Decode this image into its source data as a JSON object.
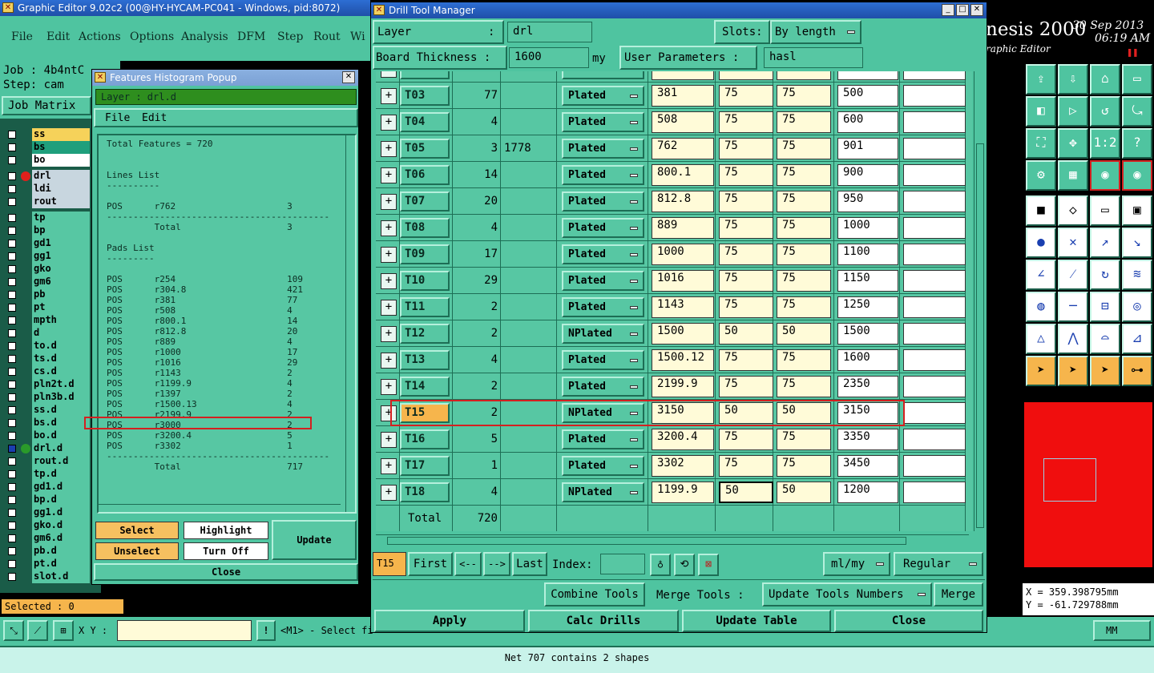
{
  "main_window": {
    "title": "Graphic Editor 9.02c2 (00@HY-HYCAM-PC041 - Windows, pid:8072)",
    "menu": [
      "File",
      "Edit",
      "Actions",
      "Options",
      "Analysis",
      "DFM",
      "Step",
      "Rout",
      "Wi"
    ],
    "job_label": "Job : 4b4ntC",
    "step_label": "Step: cam",
    "job_matrix": "Job Matrix",
    "brand": "nesis 2000",
    "brand_sub": "raphic Editor",
    "date": "30 Sep 2013",
    "time": "06:19 AM",
    "coord_x": "X = 359.398795mm",
    "coord_y": "Y = -61.729788mm",
    "units": "MM",
    "selected": "Selected : 0",
    "xy_label": "X Y :",
    "xy_value": "",
    "prompt": "<M1> - Select fi",
    "status": "Net 707 contains 2 shapes"
  },
  "layers": [
    {
      "name": "ss",
      "color": "#f6d25a"
    },
    {
      "name": "bs",
      "color": "#1f9f7c"
    },
    {
      "name": "bo",
      "color": "#ffffff"
    },
    {
      "name": "drl",
      "color": "#c8d6df",
      "dot": "#e0201c"
    },
    {
      "name": "ldi",
      "color": "#c8d6df"
    },
    {
      "name": "rout",
      "color": "#c8d6df"
    },
    {
      "name": "tp",
      "color": "#57c7a3"
    },
    {
      "name": "bp",
      "color": "#57c7a3"
    },
    {
      "name": "gd1",
      "color": "#57c7a3"
    },
    {
      "name": "gg1",
      "color": "#57c7a3"
    },
    {
      "name": "gko",
      "color": "#57c7a3"
    },
    {
      "name": "gm6",
      "color": "#57c7a3"
    },
    {
      "name": "pb",
      "color": "#57c7a3"
    },
    {
      "name": "pt",
      "color": "#57c7a3"
    },
    {
      "name": "mpth",
      "color": "#57c7a3"
    },
    {
      "name": "d",
      "color": "#57c7a3"
    },
    {
      "name": "to.d",
      "color": "#57c7a3"
    },
    {
      "name": "ts.d",
      "color": "#57c7a3"
    },
    {
      "name": "cs.d",
      "color": "#57c7a3"
    },
    {
      "name": "pln2t.d",
      "color": "#57c7a3"
    },
    {
      "name": "pln3b.d",
      "color": "#57c7a3"
    },
    {
      "name": "ss.d",
      "color": "#57c7a3"
    },
    {
      "name": "bs.d",
      "color": "#57c7a3"
    },
    {
      "name": "bo.d",
      "color": "#57c7a3"
    },
    {
      "name": "drl.d",
      "color": "#57c7a3",
      "dot": "#2a9a2a",
      "filled": true
    },
    {
      "name": "rout.d",
      "color": "#57c7a3"
    },
    {
      "name": "tp.d",
      "color": "#57c7a3"
    },
    {
      "name": "gd1.d",
      "color": "#57c7a3"
    },
    {
      "name": "bp.d",
      "color": "#57c7a3"
    },
    {
      "name": "gg1.d",
      "color": "#57c7a3"
    },
    {
      "name": "gko.d",
      "color": "#57c7a3"
    },
    {
      "name": "gm6.d",
      "color": "#57c7a3"
    },
    {
      "name": "pb.d",
      "color": "#57c7a3"
    },
    {
      "name": "pt.d",
      "color": "#57c7a3"
    },
    {
      "name": "slot.d",
      "color": "#57c7a3"
    }
  ],
  "histogram": {
    "title": "Features Histogram Popup",
    "layer_label": "Layer :  drl.d",
    "menu_file": "File",
    "menu_edit": "Edit",
    "lines": [
      "Total Features = 720",
      "",
      "",
      "Lines List",
      "----------",
      "",
      "POS      r762                     3",
      "------------------------------------------",
      "         Total                    3",
      "",
      "Pads List",
      "---------",
      "",
      "POS      r254                     109",
      "POS      r304.8                   421",
      "POS      r381                     77",
      "POS      r508                     4",
      "POS      r800.1                   14",
      "POS      r812.8                   20",
      "POS      r889                     4",
      "POS      r1000                    17",
      "POS      r1016                    29",
      "POS      r1143                    2",
      "POS      r1199.9                  4",
      "POS      r1397                    2",
      "POS      r1500.13                 4",
      "POS      r2199.9                  2",
      "POS      r3000                    2",
      "POS      r3200.4                  5",
      "POS      r3302                    1",
      "------------------------------------------",
      "         Total                    717"
    ],
    "select": "Select",
    "highlight": "Highlight",
    "update": "Update",
    "unselect": "Unselect",
    "turn_off": "Turn Off",
    "close": "Close"
  },
  "drill": {
    "title": "Drill Tool Manager",
    "layer_label": "Layer",
    "layer_colon": ":",
    "layer_value": "drl",
    "slots_label": "Slots:",
    "slots_value": "By length",
    "board_thickness_label": "Board Thickness :",
    "board_thickness_value": "1600",
    "thickness_unit": "my",
    "user_params_label": "User Parameters :",
    "user_params_value": "hasl",
    "rows": [
      {
        "tool": "T03",
        "count": "77",
        "slot": "",
        "type": "Plated",
        "size": "381",
        "tm": "75",
        "tp": "75",
        "finish": "500"
      },
      {
        "tool": "T04",
        "count": "4",
        "slot": "",
        "type": "Plated",
        "size": "508",
        "tm": "75",
        "tp": "75",
        "finish": "600"
      },
      {
        "tool": "T05",
        "count": "3",
        "slot": "1778",
        "type": "Plated",
        "size": "762",
        "tm": "75",
        "tp": "75",
        "finish": "901"
      },
      {
        "tool": "T06",
        "count": "14",
        "slot": "",
        "type": "Plated",
        "size": "800.1",
        "tm": "75",
        "tp": "75",
        "finish": "900"
      },
      {
        "tool": "T07",
        "count": "20",
        "slot": "",
        "type": "Plated",
        "size": "812.8",
        "tm": "75",
        "tp": "75",
        "finish": "950"
      },
      {
        "tool": "T08",
        "count": "4",
        "slot": "",
        "type": "Plated",
        "size": "889",
        "tm": "75",
        "tp": "75",
        "finish": "1000"
      },
      {
        "tool": "T09",
        "count": "17",
        "slot": "",
        "type": "Plated",
        "size": "1000",
        "tm": "75",
        "tp": "75",
        "finish": "1100"
      },
      {
        "tool": "T10",
        "count": "29",
        "slot": "",
        "type": "Plated",
        "size": "1016",
        "tm": "75",
        "tp": "75",
        "finish": "1150"
      },
      {
        "tool": "T11",
        "count": "2",
        "slot": "",
        "type": "Plated",
        "size": "1143",
        "tm": "75",
        "tp": "75",
        "finish": "1250"
      },
      {
        "tool": "T12",
        "count": "2",
        "slot": "",
        "type": "NPlated",
        "size": "1500",
        "tm": "50",
        "tp": "50",
        "finish": "1500"
      },
      {
        "tool": "T13",
        "count": "4",
        "slot": "",
        "type": "Plated",
        "size": "1500.12",
        "tm": "75",
        "tp": "75",
        "finish": "1600"
      },
      {
        "tool": "T14",
        "count": "2",
        "slot": "",
        "type": "Plated",
        "size": "2199.9",
        "tm": "75",
        "tp": "75",
        "finish": "2350"
      },
      {
        "tool": "T15",
        "count": "2",
        "slot": "",
        "type": "NPlated",
        "size": "3150",
        "tm": "50",
        "tp": "50",
        "finish": "3150",
        "selected": true
      },
      {
        "tool": "T16",
        "count": "5",
        "slot": "",
        "type": "Plated",
        "size": "3200.4",
        "tm": "75",
        "tp": "75",
        "finish": "3350"
      },
      {
        "tool": "T17",
        "count": "1",
        "slot": "",
        "type": "Plated",
        "size": "3302",
        "tm": "75",
        "tp": "75",
        "finish": "3450"
      },
      {
        "tool": "T18",
        "count": "4",
        "slot": "",
        "type": "NPlated",
        "size": "1199.9",
        "tm": "50",
        "tp": "50",
        "finish": "1200"
      }
    ],
    "total_label": "Total",
    "total_value": "720",
    "nav_current": "T15",
    "first": "First",
    "prev": "<--",
    "next": "-->",
    "last": "Last",
    "index_label": "Index:",
    "units": "ml/my",
    "mode": "Regular",
    "combine": "Combine Tools",
    "merge_label": "Merge Tools :",
    "merge_option": "Update Tools Numbers",
    "merge": "Merge",
    "apply": "Apply",
    "calc": "Calc Drills",
    "update_table": "Update Table",
    "close": "Close"
  },
  "colors": {
    "teal": "#4fc4a0",
    "highlight": "#d42020",
    "accent_yellow": "#f6b54c"
  }
}
